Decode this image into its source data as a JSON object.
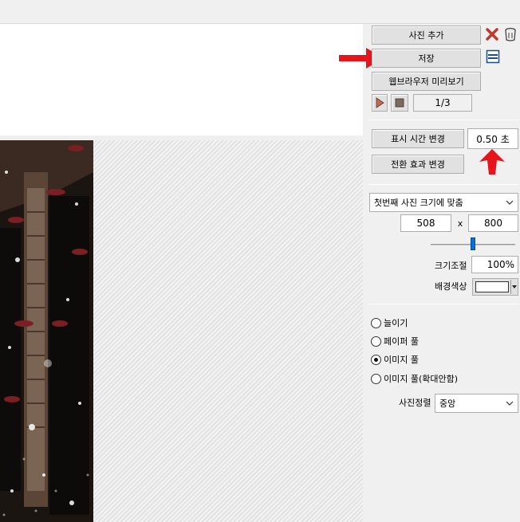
{
  "toolbar": {
    "add_photo": "사진 추가",
    "save": "저장",
    "preview": "웹브라우저 미리보기",
    "page_indicator": "1/3"
  },
  "timing": {
    "change_duration": "표시 시간 변경",
    "duration_value": "0.50 초",
    "change_transition": "전환 효과 변경"
  },
  "size": {
    "fit_mode": "첫번째 사진 크기에 맞춤",
    "width": "508",
    "x_label": "x",
    "height": "800",
    "scale_label": "크기조절",
    "scale_value": "100%",
    "slider_level": 0.5,
    "bg_color_label": "배경색상",
    "bg_color": "#ffffff"
  },
  "fill_modes": [
    {
      "label": "늘이기",
      "selected": false
    },
    {
      "label": "페이퍼 풀",
      "selected": false
    },
    {
      "label": "이미지 풀",
      "selected": true
    },
    {
      "label": "이미지 풀(확대안함)",
      "selected": false
    }
  ],
  "align": {
    "label": "사진정렬",
    "value": "중앙"
  },
  "colors": {
    "arrow": "#e8141b",
    "delete_icon": "#c0392b"
  }
}
